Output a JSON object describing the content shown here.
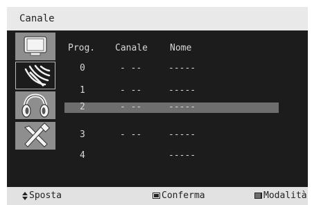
{
  "title": "Canale",
  "menu_icons": [
    {
      "name": "tv-icon",
      "active": false
    },
    {
      "name": "antenna-icon",
      "active": true
    },
    {
      "name": "headphones-icon",
      "active": false
    },
    {
      "name": "tools-icon",
      "active": false
    }
  ],
  "columns": {
    "prog": "Prog.",
    "canale": "Canale",
    "nome": "Nome"
  },
  "rows": [
    {
      "prog": "0",
      "canale": "- --",
      "nome": "-----",
      "selected": false
    },
    {
      "prog": "1",
      "canale": "- --",
      "nome": "-----",
      "selected": false
    },
    {
      "prog": "2",
      "canale": "- --",
      "nome": "-----",
      "selected": true
    },
    {
      "prog": "3",
      "canale": "- --",
      "nome": "-----",
      "selected": false
    },
    {
      "prog": "4",
      "canale": "",
      "nome": "-----",
      "selected": false
    }
  ],
  "footer": {
    "move": {
      "icon": "updown-arrows-icon",
      "label": "Sposta"
    },
    "confirm": {
      "icon": "confirm-button-icon",
      "label": "Conferma"
    },
    "mode": {
      "icon": "mode-button-icon",
      "label": "Modalità"
    }
  },
  "colors": {
    "background": "#1c1c1c",
    "selection": "#6e6e6e",
    "bars": "#e2e2e2",
    "icon_tile": "#8e8e8e"
  }
}
